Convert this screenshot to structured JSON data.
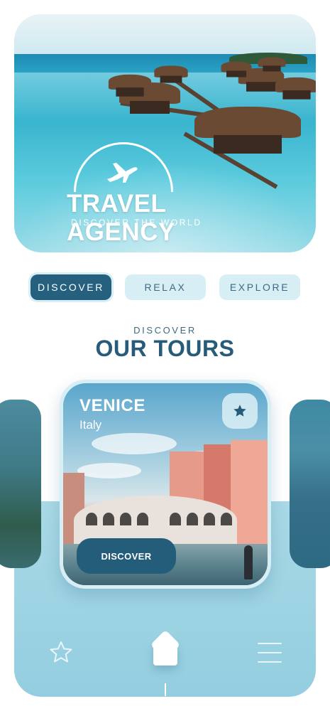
{
  "hero": {
    "brand_title": "TRAVEL AGENCY",
    "brand_subtitle": "DISCOVER THE WORLD",
    "icons": [
      "airplane-icon"
    ]
  },
  "tabs": [
    {
      "label": "DISCOVER",
      "active": true
    },
    {
      "label": "RELAX",
      "active": false
    },
    {
      "label": "EXPLORE",
      "active": false
    }
  ],
  "section": {
    "kicker": "DISCOVER",
    "title": "OUR TOURS"
  },
  "tour_card": {
    "city": "VENICE",
    "country": "Italy",
    "button_label": "DISCOVER",
    "favorite_icon": "star-icon"
  },
  "bottom_nav": {
    "items": [
      "star-icon",
      "home-icon",
      "menu-icon"
    ],
    "active": "home-icon"
  },
  "colors": {
    "primary": "#25607f",
    "tab_inactive_bg": "#d8eef5",
    "panel_bg": "#a9d9e6",
    "title_text": "#265b79"
  }
}
